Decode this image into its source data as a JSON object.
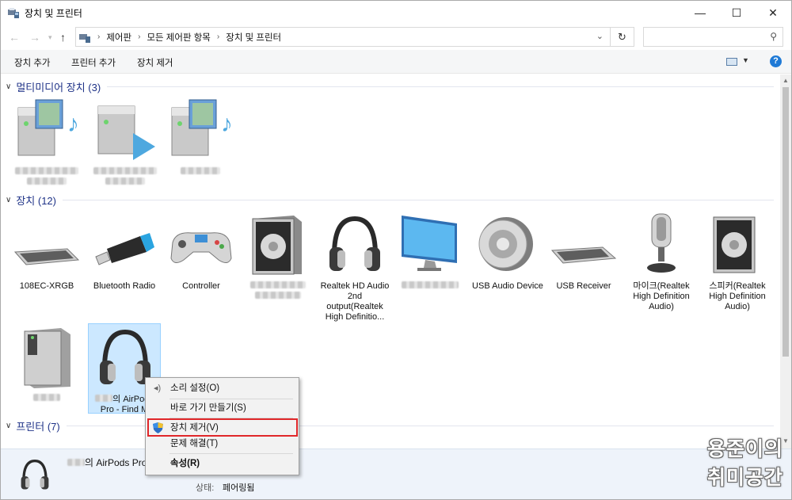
{
  "window": {
    "title": "장치 및 프린터",
    "minimize": "—",
    "maximize": "☐",
    "close": "✕"
  },
  "address": {
    "crumbs": [
      "제어판",
      "모든 제어판 항목",
      "장치 및 프린터"
    ],
    "search_placeholder": ""
  },
  "toolbar": {
    "add_device": "장치 추가",
    "add_printer": "프린터 추가",
    "remove_device": "장치 제거",
    "help": "?"
  },
  "groups": {
    "multimedia": "멀티미디어 장치 (3)",
    "devices": "장치 (12)",
    "printers": "프린터 (7)"
  },
  "devices": [
    {
      "label": "108EC-XRGB",
      "icon": "keyboard-icon"
    },
    {
      "label": "Bluetooth Radio",
      "icon": "bluetooth-dongle-icon"
    },
    {
      "label": "Controller",
      "icon": "gamepad-icon"
    },
    {
      "label": "",
      "icon": "speaker-icon"
    },
    {
      "label": "Realtek HD Audio 2nd output(Realtek High Definitio...",
      "icon": "headphones-icon"
    },
    {
      "label": "",
      "icon": "monitor-icon"
    },
    {
      "label": "USB Audio Device",
      "icon": "speaker-round-icon"
    },
    {
      "label": "USB Receiver",
      "icon": "keyboard-icon"
    },
    {
      "label": "마이크(Realtek High Definition Audio)",
      "icon": "microphone-icon"
    },
    {
      "label": "스피커(Realtek High Definition Audio)",
      "icon": "speaker-icon"
    }
  ],
  "selected_device": {
    "label_line1": "의 AirPods",
    "label_line2": "Pro - Find M"
  },
  "context_menu": {
    "sound_settings": "소리 설정(O)",
    "create_shortcut": "바로 가기 만들기(S)",
    "remove_device": "장치 제거(V)",
    "troubleshoot": "문제 해결(T)",
    "properties": "속성(R)"
  },
  "details": {
    "name": "의 AirPods Pro",
    "status_label": "상태:",
    "status_value": "페어링됨"
  },
  "watermark": {
    "line1": "용준이의",
    "line2": "취미공간"
  },
  "colors": {
    "group_header": "#1e3287",
    "selection": "#cce8ff",
    "highlight_box": "#e0272a"
  }
}
